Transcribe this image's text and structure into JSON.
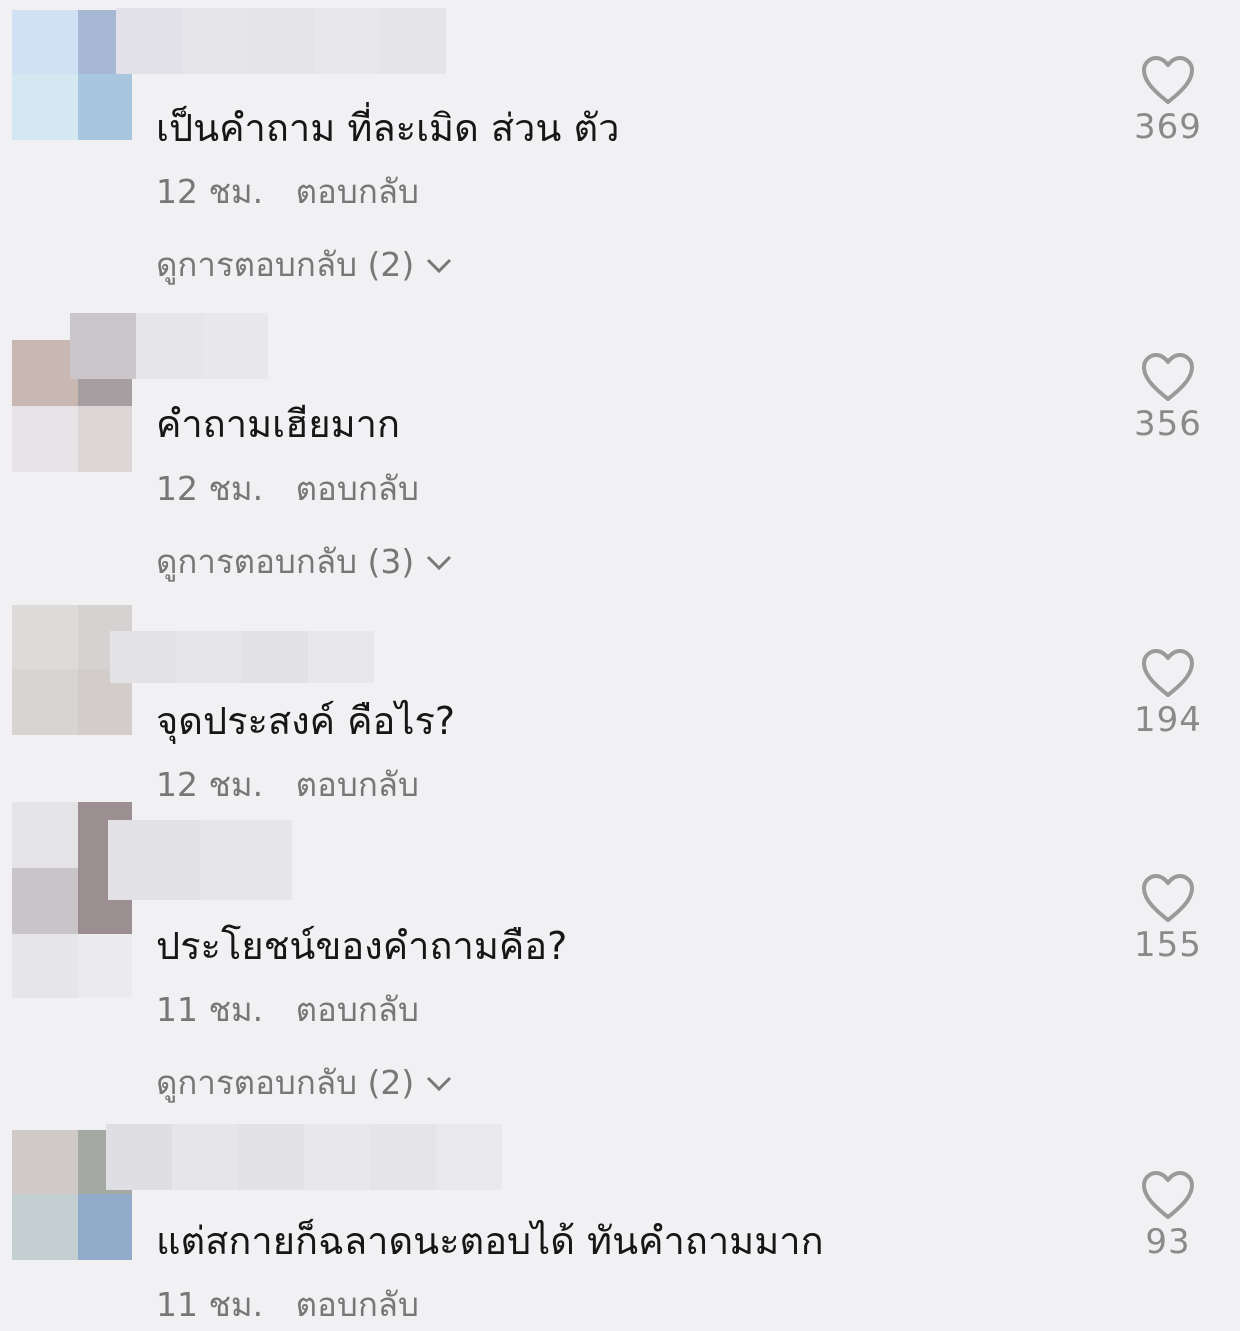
{
  "comments": [
    {
      "text": "เป็นคำถาม  ที่ละเมิด  ส่วน ตัว",
      "time": "12 ชม.",
      "reply_label": "ตอบกลับ",
      "view_replies": "ดูการตอบกลับ (2)",
      "likes": "369",
      "avatar_colors": [
        "#cfe1f2",
        "#a7b8d4",
        "#d4e8f2",
        "#a8c7de"
      ]
    },
    {
      "text": "คำถามเฮียมาก",
      "time": "12 ชม.",
      "reply_label": "ตอบกลับ",
      "view_replies": "ดูการตอบกลับ (3)",
      "likes": "356",
      "avatar_colors": [
        "#c9b8b2",
        "#a59fa2",
        "#e6e2e5",
        "#dcd5d5"
      ]
    },
    {
      "text": "จุดประสงค์ คือไร?",
      "time": "12 ชม.",
      "reply_label": "ตอบกลับ",
      "view_replies": "",
      "likes": "194",
      "avatar_colors": [
        "#dedada",
        "#d6d2d2",
        "#d8d4d2",
        "#d2cdcb"
      ]
    },
    {
      "text": "ประโยชน์ของคำถามคือ?",
      "time": "11 ชม.",
      "reply_label": "ตอบกลับ",
      "view_replies": "ดูการตอบกลับ (2)",
      "likes": "155",
      "avatar_colors": [
        "#e4e3e6",
        "#9b8f91",
        "#e4e3e6",
        "#e8e7ea"
      ]
    },
    {
      "text": "แต่สกายก็ฉลาดนะตอบได้ ทันคำถามมาก",
      "time": "11 ชม.",
      "reply_label": "ตอบกลับ",
      "view_replies": "",
      "likes": "93",
      "avatar_colors": [
        "#cfcac8",
        "#a4a9a4",
        "#c4cfd2",
        "#92abcb"
      ]
    }
  ],
  "colors": {
    "background": "#f1f1f3",
    "text": "#161616",
    "meta": "#777777",
    "heart": "#9a9a9a"
  },
  "icons": {
    "like": "heart-outline-icon",
    "expand": "chevron-down-icon"
  }
}
